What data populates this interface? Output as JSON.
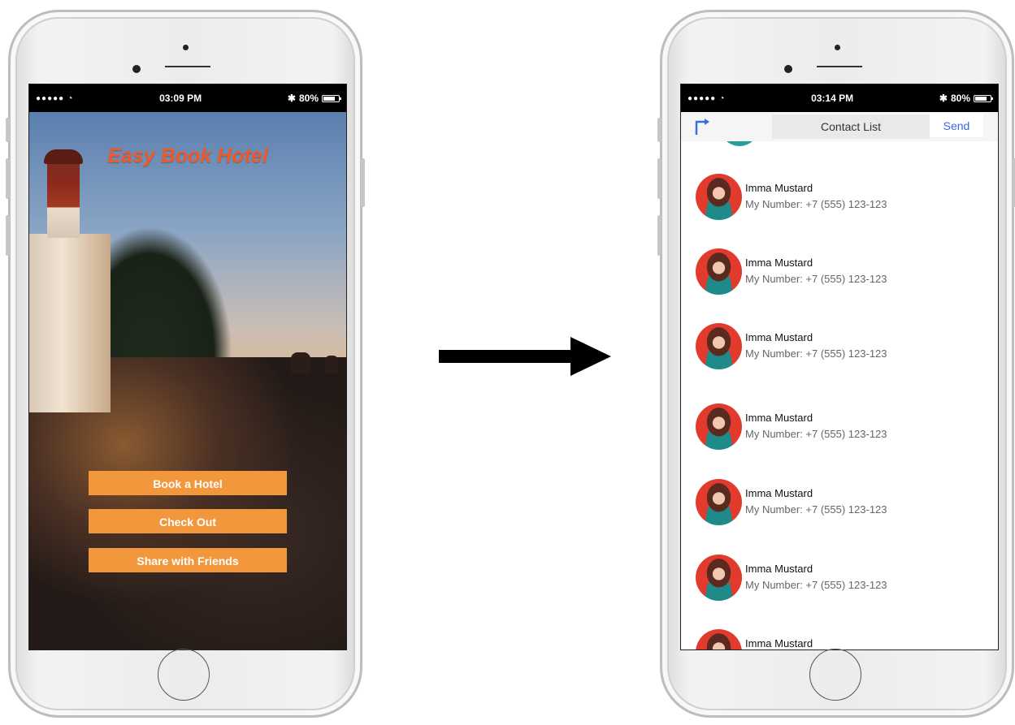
{
  "left_phone": {
    "status": {
      "carrier": "●●●●● ",
      "time": "03:09 PM",
      "bluetooth": "✱",
      "battery": "80%",
      "battery_level": 0.8
    },
    "app_title": "Easy Book Hotel",
    "buttons": [
      {
        "label": "Book a Hotel"
      },
      {
        "label": "Check Out"
      },
      {
        "label": "Share with Friends"
      }
    ]
  },
  "right_phone": {
    "status": {
      "carrier": "●●●●● ",
      "time": "03:14 PM",
      "bluetooth": "✱",
      "battery": "80%",
      "battery_level": 0.8
    },
    "nav": {
      "title": "Contact List",
      "send_label": "Send",
      "back_icon": "back-arrow-icon"
    },
    "contacts": [
      {
        "name": "Imma Mustard",
        "number": "My Number: +7 (555) 123-123"
      },
      {
        "name": "Imma Mustard",
        "number": "My Number: +7 (555) 123-123"
      },
      {
        "name": "Imma Mustard",
        "number": "My Number: +7 (555) 123-123"
      },
      {
        "name": "Imma Mustard",
        "number": "My Number: +7 (555) 123-123"
      },
      {
        "name": "Imma Mustard",
        "number": "My Number: +7 (555) 123-123"
      },
      {
        "name": "Imma Mustard",
        "number": "My Number: +7 (555) 123-123"
      },
      {
        "name": "Imma Mustard",
        "number": ""
      }
    ]
  },
  "colors": {
    "title_orange": "#ec5a2c",
    "button_orange": "#f3973d",
    "send_blue": "#3a66e0"
  }
}
